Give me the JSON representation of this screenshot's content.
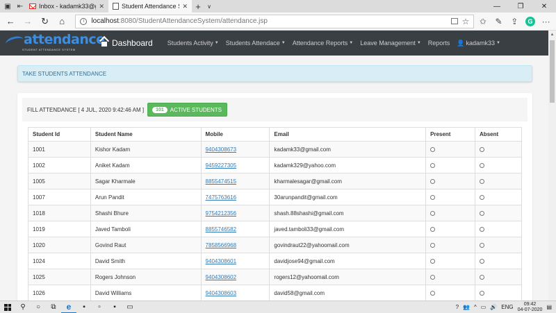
{
  "browser": {
    "tabs": [
      {
        "title": "Inbox - kadamk33@gmail.c",
        "active": false
      },
      {
        "title": "Student Attendance Sys",
        "active": true
      }
    ],
    "url_host": "localhost",
    "url_path": ":8080/StudentAttendanceSystem/attendance.jsp"
  },
  "navbar": {
    "brand": "attendance",
    "brand_tagline": "STUDENT ATTENDANCE SYSTEM",
    "dashboard": "Dashboard",
    "menu": [
      {
        "label": "Students Activity"
      },
      {
        "label": "Students Attendace"
      },
      {
        "label": "Attendance Reports"
      },
      {
        "label": "Leave Management"
      },
      {
        "label": "Reports"
      },
      {
        "label": "kadamk33"
      }
    ]
  },
  "alert": {
    "text": "TAKE STUDENTS ATTENDANCE"
  },
  "panel": {
    "fill_label": "FILL ATTENDANCE  [ 4 JUL, 2020 9:42:46 AM ]",
    "active_count": "101",
    "active_label": "ACTIVE STUDENTS"
  },
  "table": {
    "headers": [
      "Student Id",
      "Student Name",
      "Mobile",
      "Email",
      "Present",
      "Absent"
    ],
    "rows": [
      {
        "id": "1001",
        "name": "Kishor Kadam",
        "mobile": "9404308673",
        "email": "kadamk33@gmail.com"
      },
      {
        "id": "1002",
        "name": "Aniket Kadam",
        "mobile": "9459227305",
        "email": "kadamk329@yahoo.com"
      },
      {
        "id": "1005",
        "name": "Sagar Kharmale",
        "mobile": "8855474515",
        "email": "kharmalesagar@gmail.com"
      },
      {
        "id": "1007",
        "name": "Arun Pandit",
        "mobile": "7475763616",
        "email": "30arunpandit@gmail.com"
      },
      {
        "id": "1018",
        "name": "Shashi Bhure",
        "mobile": "9754212356",
        "email": "shash.88shashi@gmail.com"
      },
      {
        "id": "1019",
        "name": "Javed Tamboli",
        "mobile": "8855746582",
        "email": "javed.tamboli33@gmail.com"
      },
      {
        "id": "1020",
        "name": "Govind Raut",
        "mobile": "7858566968",
        "email": "govindraut22@yahoomail.com"
      },
      {
        "id": "1024",
        "name": "David Smith",
        "mobile": "9404308601",
        "email": "davidjose94@gmail.com"
      },
      {
        "id": "1025",
        "name": "Rogers Johnson",
        "mobile": "9404308602",
        "email": "rogers12@yahoomail.com"
      },
      {
        "id": "1026",
        "name": "David Williams",
        "mobile": "9404308603",
        "email": "david58@gmail.com"
      }
    ]
  },
  "taskbar": {
    "language": "ENG",
    "time": "09:42",
    "date": "04-07-2020"
  },
  "colors": {
    "navbar_bg": "#3a3f44",
    "brand_blue": "#3d8ee0",
    "success_green": "#5cb85c",
    "alert_bg": "#d9edf7",
    "link_blue": "#337ab7"
  }
}
